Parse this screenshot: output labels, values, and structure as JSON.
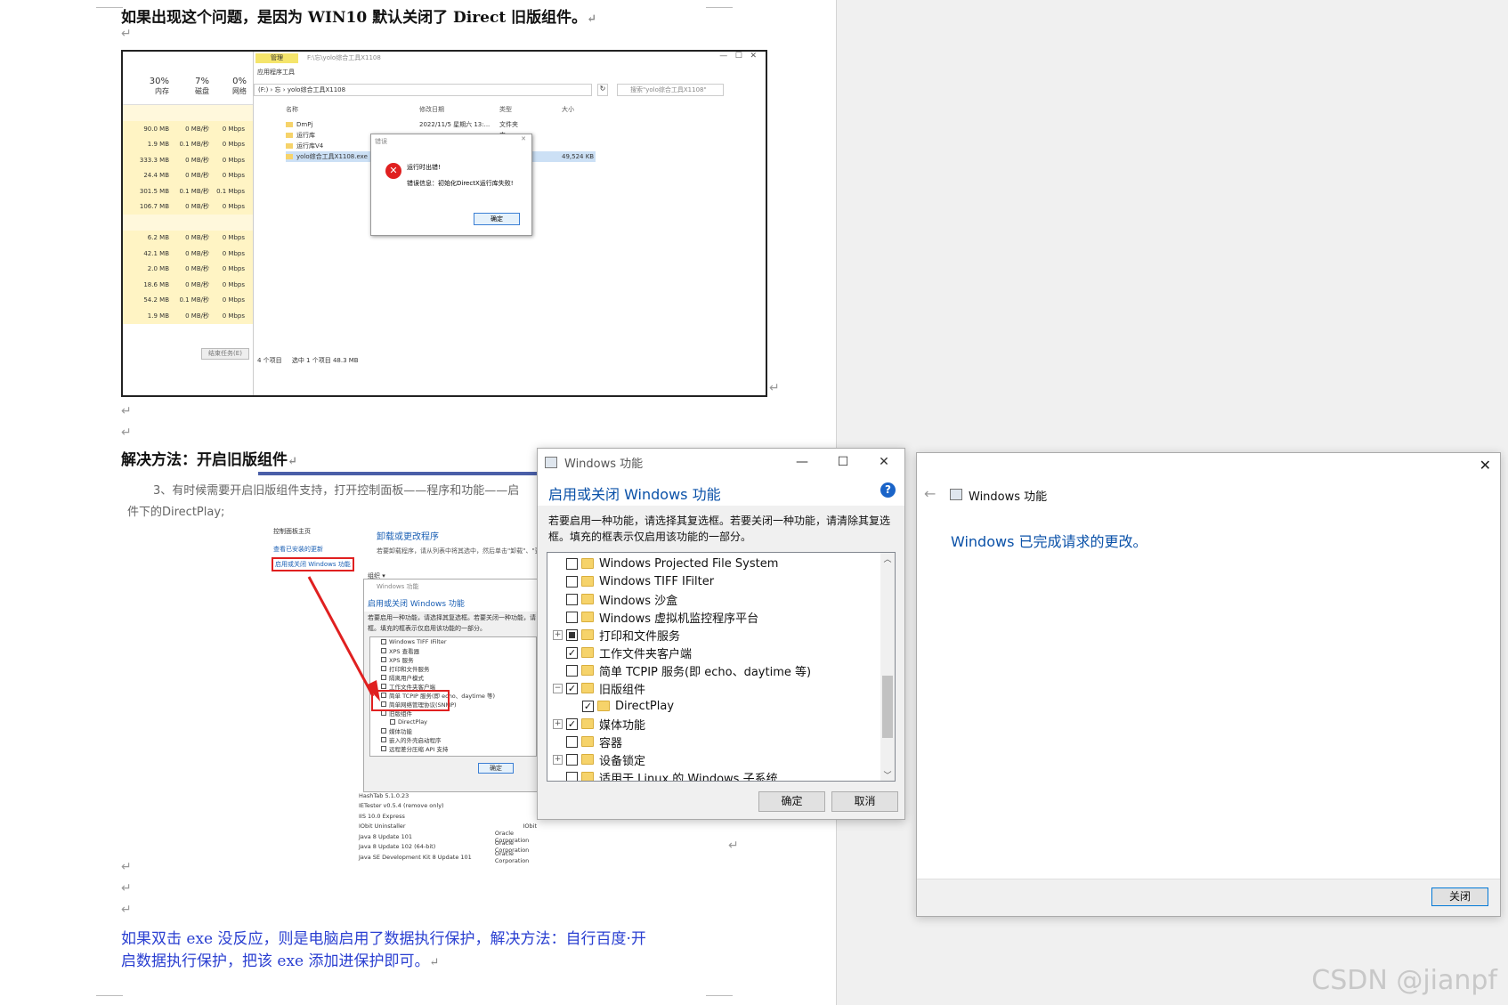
{
  "doc": {
    "line1": "如果出现这个问题，是因为 WIN10 默认关闭了 Direct 旧版组件。",
    "heading": "解决方法：开启旧版组件",
    "step3a": "3、有时候需要开启旧版组件支持，打开控制面板——程序和功能——启",
    "step3b": "件下的DirectPlay;",
    "dep1": "如果双击 exe 没反应，则是电脑启用了数据执行保护，解决方法：自行百度·开",
    "dep2": "启数据执行保护，把该 exe 添加进保护即可。",
    "pilcrow": "↵"
  },
  "shot1": {
    "tab_manage": "管理",
    "tab_apptools": "应用程序工具",
    "path_title": "F:\\忘\\yolo综合工具X1108",
    "address": "yolo综合工具X1108",
    "address_prefix": "(F:) › 忘 ›",
    "search_placeholder": "搜索\"yolo综合工具X1108\"",
    "col_name": "名称",
    "col_date": "修改日期",
    "col_type": "类型",
    "col_size": "大小",
    "files": [
      "DmPj",
      "运行库",
      "运行库V4",
      "yolo综合工具X1108.exe"
    ],
    "file_date": "2022/11/5 星期六 13:...",
    "file_types": [
      "文件夹",
      "夹",
      "夹",
      "程序"
    ],
    "file_size": "49,524 KB",
    "status_left": "4 个项目",
    "status_sel": "选中 1 个项目  48.3 MB",
    "tm_headers": {
      "mem_pct": "30%",
      "disk_pct": "7%",
      "net_pct": "0%",
      "mem": "内存",
      "disk": "磁盘",
      "net": "网络"
    },
    "tm_rows": [
      [
        "90.0 MB",
        "0 MB/秒",
        "0 Mbps"
      ],
      [
        "1.9 MB",
        "0.1 MB/秒",
        "0 Mbps"
      ],
      [
        "333.3 MB",
        "0 MB/秒",
        "0 Mbps"
      ],
      [
        "24.4 MB",
        "0 MB/秒",
        "0 Mbps"
      ],
      [
        "301.5 MB",
        "0.1 MB/秒",
        "0.1 Mbps"
      ],
      [
        "106.7 MB",
        "0 MB/秒",
        "0 Mbps"
      ],
      [
        "",
        "",
        ""
      ],
      [
        "6.2 MB",
        "0 MB/秒",
        "0 Mbps"
      ],
      [
        "42.1 MB",
        "0 MB/秒",
        "0 Mbps"
      ],
      [
        "2.0 MB",
        "0 MB/秒",
        "0 Mbps"
      ],
      [
        "18.6 MB",
        "0 MB/秒",
        "0 Mbps"
      ],
      [
        "54.2 MB",
        "0.1 MB/秒",
        "0 Mbps"
      ],
      [
        "1.9 MB",
        "0 MB/秒",
        "0 Mbps"
      ]
    ],
    "end_task": "结束任务(E)",
    "err_title": "错误",
    "err_line1": "运行时出错!",
    "err_line2": "错误信息：初始化DirectX运行库失败!",
    "err_ok": "确定"
  },
  "shot2": {
    "cp_home": "控制面板主页",
    "cp_updates": "查看已安装的更新",
    "cp_features": "启用或关闭 Windows 功能",
    "uninstall_title": "卸载或更改程序",
    "uninstall_desc": "若要卸载程序，请从列表中将其选中，然后单击\"卸载\"、\"更",
    "organize": "组织 ▾",
    "mini_title": "Windows 功能",
    "mini_head": "启用或关闭 Windows 功能",
    "mini_desc": "若要启用一种功能，请选择其复选框。若要关闭一种功能，请",
    "mini_desc2": "框。填充的框表示仅启用该功能的一部分。",
    "mini_items": [
      "Windows TIFF IFilter",
      "XPS 查看器",
      "XPS 服务",
      "打印和文件服务",
      "隔离用户模式",
      "工作文件夹客户端",
      "简单 TCPIP 服务(即 echo、daytime 等)",
      "简单网络管理协议(SNMP)",
      "旧版组件",
      "DirectPlay",
      "媒体功能",
      "嵌入的外壳启动程序",
      "远程差分压缩 API 支持"
    ],
    "mini_ok": "确定",
    "programs": [
      "HashTab 5.1.0.23",
      "IETester v0.5.4 (remove only)",
      "IIS 10.0 Express",
      "IObit Uninstaller",
      "Java 8 Update 101",
      "Java 8 Update 102 (64-bit)",
      "Java SE Development Kit 8 Update 101"
    ],
    "publishers": [
      "",
      "",
      "",
      "IObit",
      "Oracle Corporation",
      "Oracle Corporation",
      "Oracle Corporation"
    ]
  },
  "features_dialog": {
    "title": "Windows 功能",
    "min": "—",
    "max": "☐",
    "close": "✕",
    "heading": "启用或关闭 Windows 功能",
    "help": "?",
    "desc1": "若要启用一种功能，请选择其复选框。若要关闭一种功能，请清除其复选",
    "desc2": "框。填充的框表示仅启用该功能的一部分。",
    "items": [
      {
        "label": "Windows Projected File System",
        "state": "",
        "exp": ""
      },
      {
        "label": "Windows TIFF IFilter",
        "state": "",
        "exp": ""
      },
      {
        "label": "Windows 沙盒",
        "state": "",
        "exp": ""
      },
      {
        "label": "Windows 虚拟机监控程序平台",
        "state": "",
        "exp": ""
      },
      {
        "label": "打印和文件服务",
        "state": "part",
        "exp": "+"
      },
      {
        "label": "工作文件夹客户端",
        "state": "✓",
        "exp": ""
      },
      {
        "label": "简单 TCPIP 服务(即 echo、daytime 等)",
        "state": "",
        "exp": ""
      },
      {
        "label": "旧版组件",
        "state": "✓",
        "exp": "−"
      },
      {
        "label": "DirectPlay",
        "state": "✓",
        "exp": "child"
      },
      {
        "label": "媒体功能",
        "state": "✓",
        "exp": "+"
      },
      {
        "label": "容器",
        "state": "",
        "exp": ""
      },
      {
        "label": "设备锁定",
        "state": "",
        "exp": "+"
      },
      {
        "label": "适用于 Linux 的 Windows 子系统",
        "state": "",
        "exp": ""
      }
    ],
    "ok": "确定",
    "cancel": "取消"
  },
  "done_dialog": {
    "close_x": "✕",
    "back": "←",
    "title": "Windows 功能",
    "message": "Windows 已完成请求的更改。",
    "close_btn": "关闭"
  },
  "watermark": "CSDN @jianpf",
  "colors": {
    "link_blue": "#1a5fb4",
    "dialog_blue": "#0a51a8",
    "text_blue": "#2a3fd1",
    "red": "#e02020"
  }
}
